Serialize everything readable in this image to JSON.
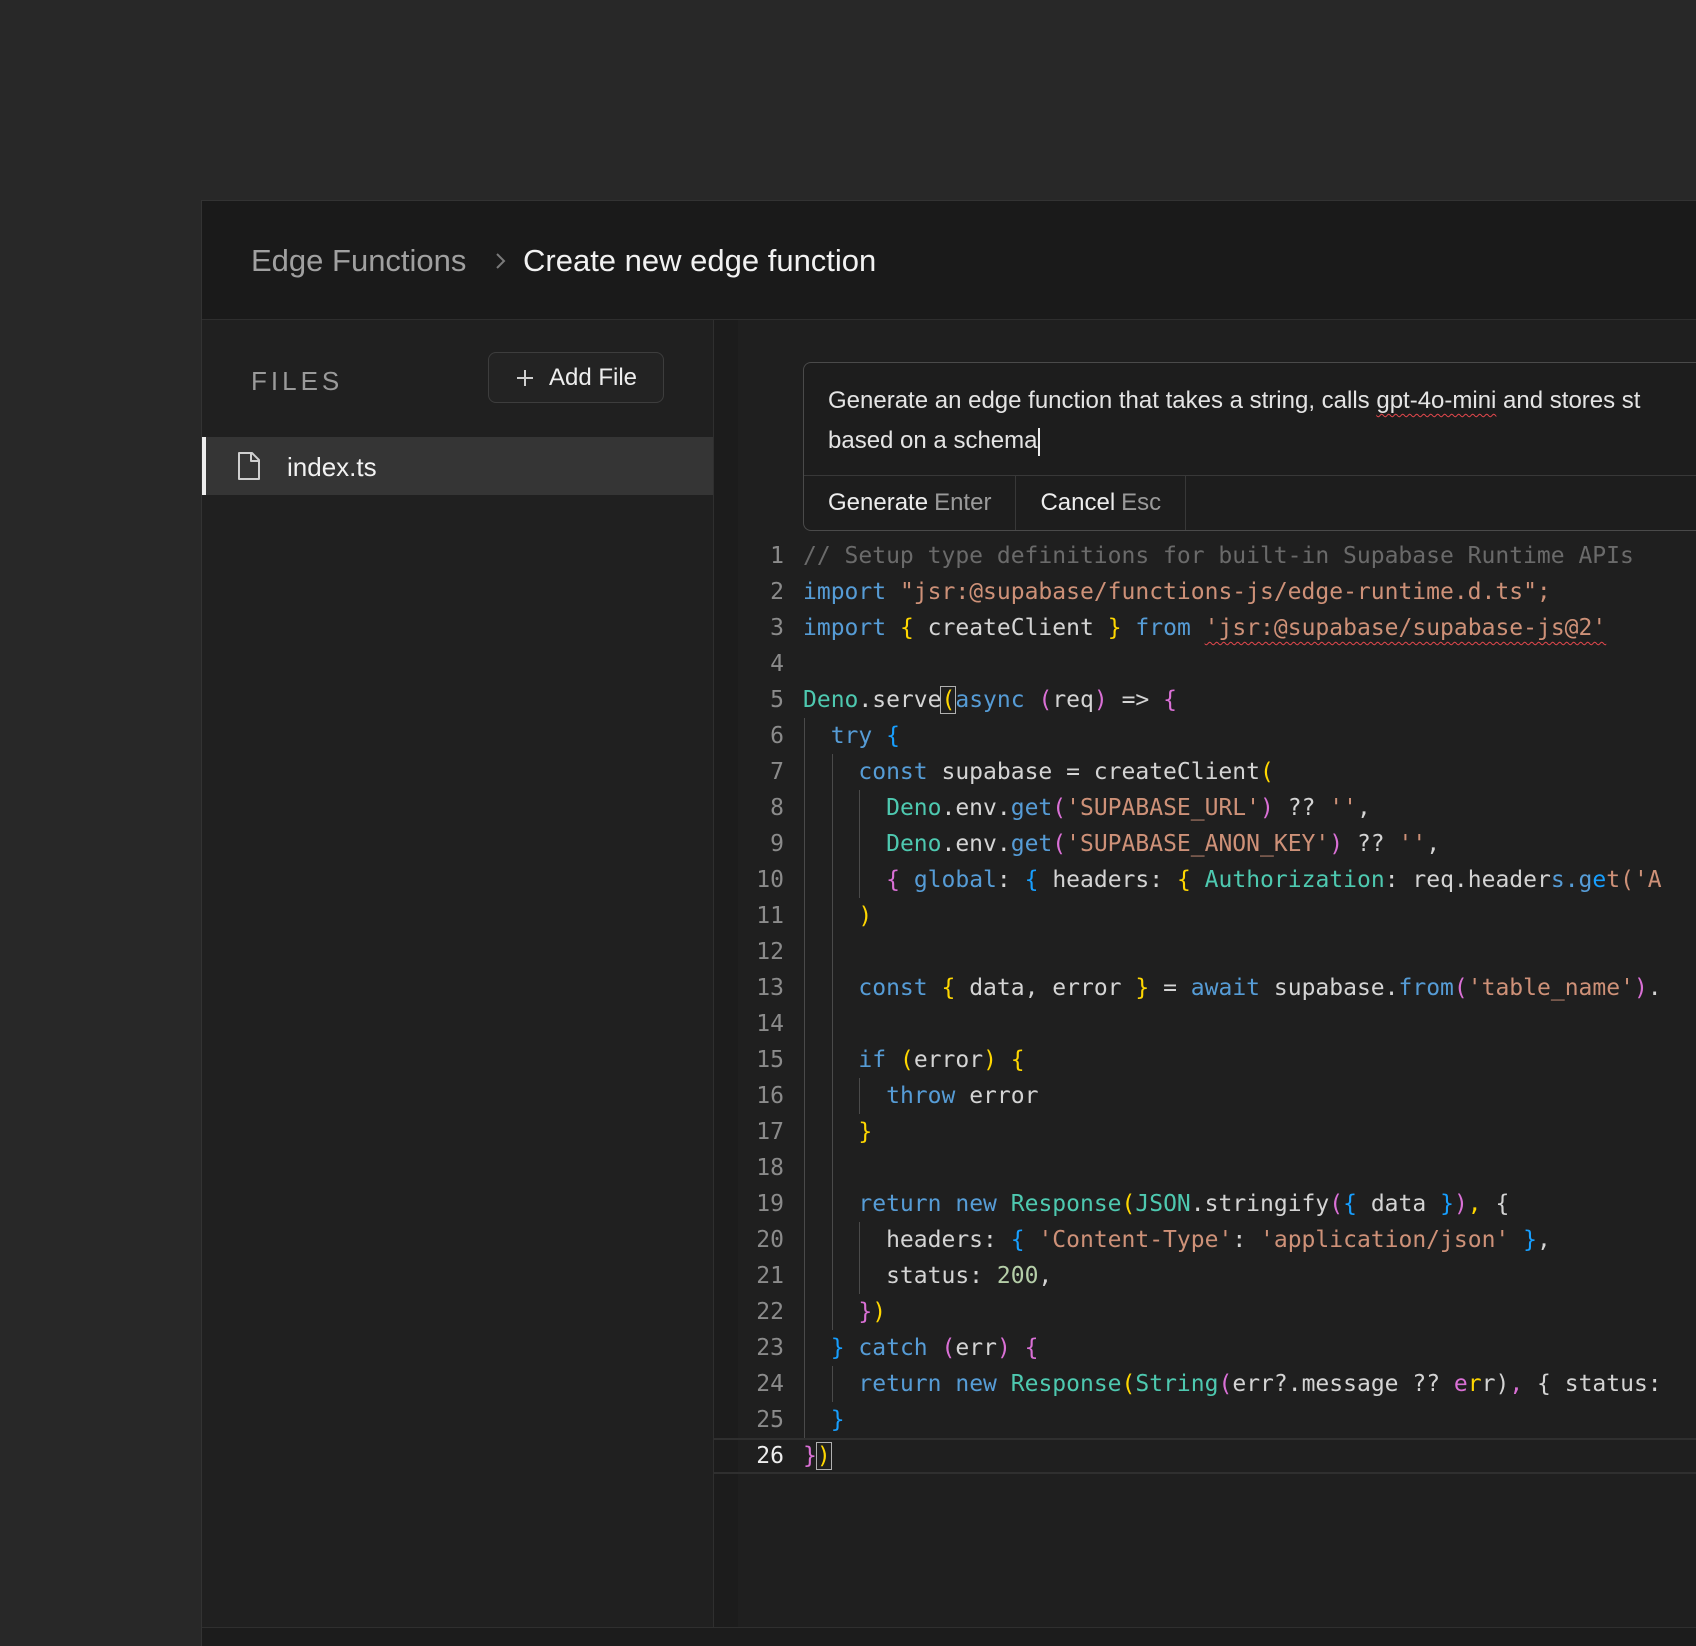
{
  "header": {
    "breadcrumb_parent": "Edge Functions",
    "breadcrumb_current": "Create new edge function"
  },
  "sidebar": {
    "title": "FILES",
    "add_file_label": "Add File",
    "files": [
      {
        "name": "index.ts",
        "selected": true
      }
    ]
  },
  "prompt": {
    "line1_before": "Generate an edge function that takes a string, calls ",
    "line1_misspelled": "gpt-4o-mini",
    "line1_after": " and stores st",
    "line2": "based on a schema",
    "generate_label": "Generate",
    "generate_key": "Enter",
    "cancel_label": "Cancel",
    "cancel_key": "Esc"
  },
  "editor": {
    "active_line": 26,
    "lines": [
      "// Setup type definitions for built-in Supabase Runtime APIs",
      "import \"jsr:@supabase/functions-js/edge-runtime.d.ts\";",
      "import { createClient } from 'jsr:@supabase/supabase-js@2'",
      "",
      "Deno.serve(async (req) => {",
      "  try {",
      "    const supabase = createClient(",
      "      Deno.env.get('SUPABASE_URL') ?? '',",
      "      Deno.env.get('SUPABASE_ANON_KEY') ?? '',",
      "      { global: { headers: { Authorization: req.headers.get('A",
      "    )",
      "",
      "    const { data, error } = await supabase.from('table_name').",
      "",
      "    if (error) {",
      "      throw error",
      "    }",
      "",
      "    return new Response(JSON.stringify({ data }), {",
      "      headers: { 'Content-Type': 'application/json' },",
      "      status: 200,",
      "    })",
      "  } catch (err) {",
      "    return new Response(String(err?.message ?? err), { status:",
      "  }",
      "})"
    ]
  },
  "colors": {
    "comment": "#6a6a6a",
    "keyword": "#569cd6",
    "string": "#ce9178",
    "type": "#4ec9b0",
    "number": "#b5cea8",
    "bracket_gold": "#ffd700",
    "bracket_purple": "#da70d6",
    "bracket_blue": "#179fff"
  },
  "icons": [
    "chevron-right-icon",
    "plus-icon",
    "file-icon"
  ]
}
